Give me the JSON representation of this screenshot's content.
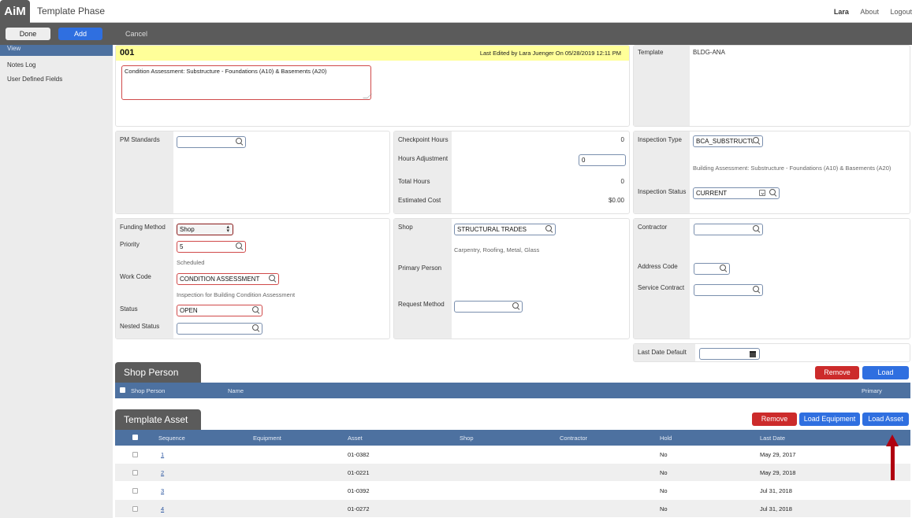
{
  "app": {
    "logo": "AiM",
    "title": "Template Phase"
  },
  "top_links": {
    "user": "Lara",
    "about": "About",
    "logout": "Logout"
  },
  "actions": {
    "done": "Done",
    "add": "Add",
    "cancel": "Cancel"
  },
  "sidebar": {
    "items": [
      {
        "label": "View",
        "active": true
      },
      {
        "label": "Notes Log"
      },
      {
        "label": "User Defined Fields"
      }
    ]
  },
  "header": {
    "record_id": "001",
    "last_edited": "Last Edited by Lara Juenger On 05/28/2019 12:11 PM",
    "description": "Condition Assessment: Substructure - Foundations (A10) & Basements (A20)",
    "template_label": "Template",
    "template_value": "BLDG-ANA"
  },
  "pm": {
    "label": "PM Standards",
    "value": ""
  },
  "hours": {
    "checkpoint_label": "Checkpoint Hours",
    "checkpoint_value": "0",
    "adjustment_label": "Hours Adjustment",
    "adjustment_value": "0",
    "total_label": "Total Hours",
    "total_value": "0",
    "cost_label": "Estimated Cost",
    "cost_value": "$0.00"
  },
  "inspection": {
    "type_label": "Inspection Type",
    "type_value": "BCA_SUBSTRUCTURE",
    "type_desc": "Building Assessment: Substructure - Foundations (A10) & Basements (A20)",
    "status_label": "Inspection Status",
    "status_value": "CURRENT"
  },
  "work": {
    "funding_label": "Funding Method",
    "funding_value": "Shop",
    "priority_label": "Priority",
    "priority_value": "5",
    "priority_desc": "Scheduled",
    "workcode_label": "Work Code",
    "workcode_value": "CONDITION ASSESSMENT",
    "workcode_desc": "Inspection for Building Condition Assessment",
    "status_label": "Status",
    "status_value": "OPEN",
    "nested_label": "Nested Status",
    "nested_value": ""
  },
  "shop": {
    "shop_label": "Shop",
    "shop_value": "STRUCTURAL TRADES",
    "shop_desc": "Carpentry, Roofing, Metal, Glass",
    "primary_label": "Primary Person",
    "request_label": "Request Method",
    "request_value": ""
  },
  "contractor": {
    "contractor_label": "Contractor",
    "contractor_value": "",
    "address_label": "Address Code",
    "address_value": "",
    "service_label": "Service Contract",
    "service_value": ""
  },
  "last_date": {
    "label": "Last Date Default",
    "value": ""
  },
  "shop_person": {
    "title": "Shop Person",
    "remove": "Remove",
    "load": "Load",
    "columns": [
      "Shop Person",
      "Name",
      "Primary"
    ]
  },
  "template_asset": {
    "title": "Template Asset",
    "remove": "Remove",
    "load_equipment": "Load Equipment",
    "load_asset": "Load Asset",
    "columns": [
      "Sequence",
      "Equipment",
      "Asset",
      "Shop",
      "Contractor",
      "Hold",
      "Last Date"
    ],
    "rows": [
      {
        "sequence": "1",
        "equipment": "",
        "asset": "01-0382",
        "shop": "",
        "contractor": "",
        "hold": "No",
        "last_date": "May 29, 2017"
      },
      {
        "sequence": "2",
        "equipment": "",
        "asset": "01-0221",
        "shop": "",
        "contractor": "",
        "hold": "No",
        "last_date": "May 29, 2018"
      },
      {
        "sequence": "3",
        "equipment": "",
        "asset": "01-0392",
        "shop": "",
        "contractor": "",
        "hold": "No",
        "last_date": "Jul 31, 2018"
      },
      {
        "sequence": "4",
        "equipment": "",
        "asset": "01-0272",
        "shop": "",
        "contractor": "",
        "hold": "No",
        "last_date": "Jul 31, 2018"
      }
    ]
  },
  "colors": {
    "accent_blue": "#2f6fe0",
    "danger_red": "#cc2b2b",
    "grid_header": "#4d71a0",
    "header_yellow": "#ffff99",
    "annotation_arrow": "#b00010"
  }
}
